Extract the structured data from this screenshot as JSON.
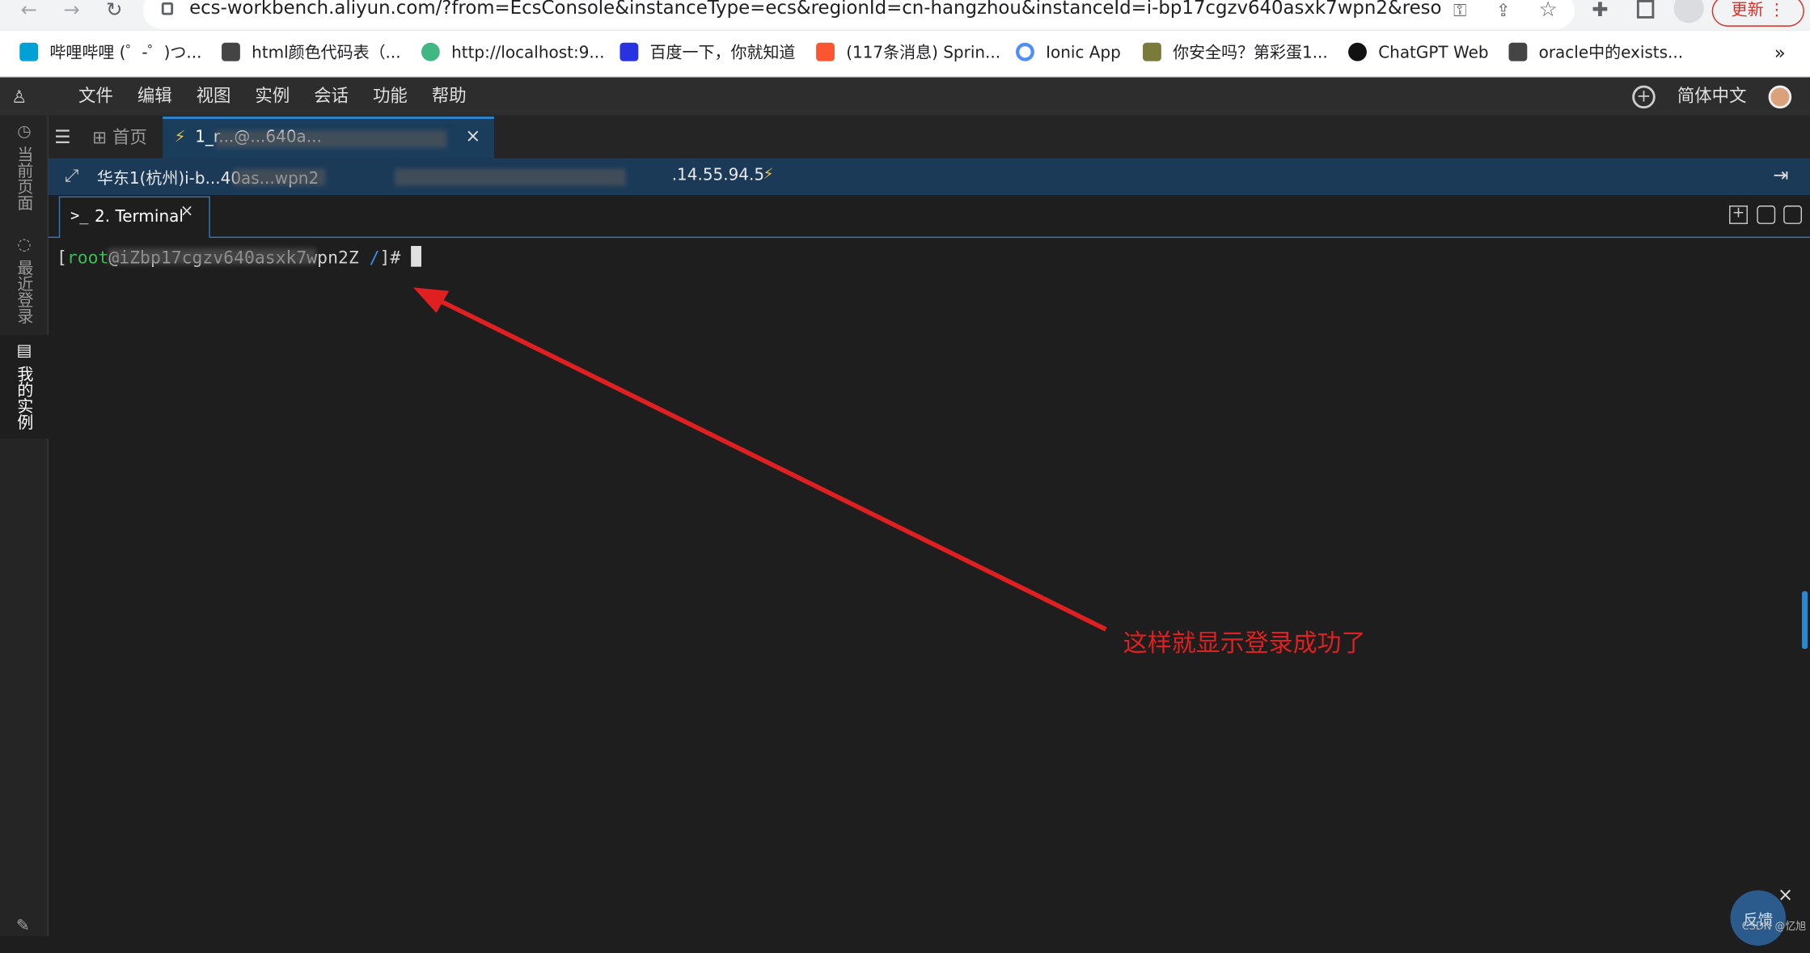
{
  "browser": {
    "back_icon": "back-arrow-icon",
    "forward_icon": "forward-arrow-icon",
    "reload_icon": "reload-icon",
    "url": "ecs-workbench.aliyun.com/?from=EcsConsole&instanceType=ecs&regionId=cn-hangzhou&instanceId=i-bp17cgzv640asxk7wpn2&resour...",
    "update_label": "更新"
  },
  "bookmarks": [
    {
      "label": "哔哩哔哩 (゜-゜)つ...",
      "color": "#00a1d6"
    },
    {
      "label": "html颜色代码表（...",
      "color": "#444444"
    },
    {
      "label": "http://localhost:9...",
      "color": "#41b883"
    },
    {
      "label": "百度一下，你就知道",
      "color": "#2932e1"
    },
    {
      "label": "(117条消息) Sprin...",
      "color": "#fc5531"
    },
    {
      "label": "Ionic App",
      "color": "#4e8ef7"
    },
    {
      "label": "你安全吗？第彩蛋1...",
      "color": "#7a7a3a"
    },
    {
      "label": "ChatGPT Web",
      "color": "#111111"
    },
    {
      "label": "oracle中的exists...",
      "color": "#444444"
    }
  ],
  "bookmarks_more": "»",
  "menu": {
    "items": [
      "文件",
      "编辑",
      "视图",
      "实例",
      "会话",
      "功能",
      "帮助"
    ],
    "language": "简体中文"
  },
  "sidebar": {
    "current_page": "当前页面",
    "recent_login": "最近登录",
    "my_instances": "我的实例"
  },
  "tabs": {
    "home": "首页",
    "session": "1_r...@...640a..."
  },
  "infobar": {
    "region": "华东1(杭州)i-b...40as...wpn2",
    "ip": ".14.55.94.5"
  },
  "terminal": {
    "tab_label": "2. Terminal",
    "prompt_user": "root",
    "prompt_host": "iZbp17cgzv640asxk7wpn2Z",
    "prompt_path": "/",
    "prompt_symbol": "]#"
  },
  "annotation": {
    "text": "这样就显示登录成功了",
    "color": "#e02020"
  },
  "feedback": {
    "label": "反馈",
    "watermark": "CSDN @忆旭"
  }
}
